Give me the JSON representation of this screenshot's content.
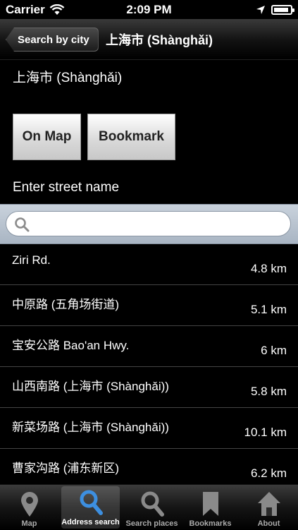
{
  "status_bar": {
    "carrier": "Carrier",
    "time": "2:09 PM"
  },
  "nav": {
    "back_label": "Search by city",
    "title": "上海市 (Shànghǎi)"
  },
  "content": {
    "city_heading": "上海市 (Shànghǎi)",
    "on_map_label": "On Map",
    "bookmark_label": "Bookmark",
    "street_label": "Enter street name",
    "search_value": "",
    "search_placeholder": ""
  },
  "results": [
    {
      "name": "Ziri Rd.",
      "distance": "4.8 km"
    },
    {
      "name": "中原路 (五角场街道)",
      "distance": "5.1 km"
    },
    {
      "name": "宝安公路 Bao'an Hwy.",
      "distance": "6 km"
    },
    {
      "name": "山西南路 (上海市 (Shànghǎi))",
      "distance": "5.8 km"
    },
    {
      "name": "新菜场路 (上海市 (Shànghǎi))",
      "distance": "10.1 km"
    },
    {
      "name": "曹家沟路 (浦东新区)",
      "distance": "6.2 km"
    }
  ],
  "tabs": [
    {
      "label": "Map",
      "icon": "map-pin-icon"
    },
    {
      "label": "Address search",
      "icon": "magnifier-icon"
    },
    {
      "label": "Search places",
      "icon": "magnifier-icon"
    },
    {
      "label": "Bookmarks",
      "icon": "bookmark-icon"
    },
    {
      "label": "About",
      "icon": "home-icon"
    }
  ],
  "active_tab": "Address search",
  "colors": {
    "accent_blue": "#2a7fd4",
    "search_bar": "#b4bfcc"
  }
}
